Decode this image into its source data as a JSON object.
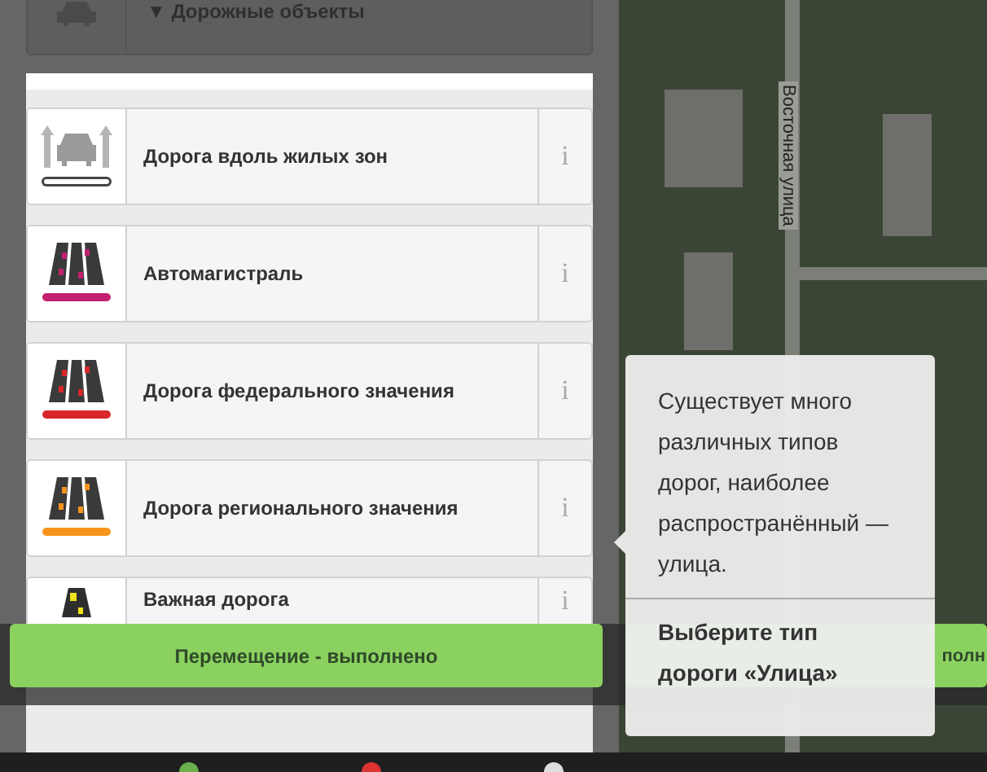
{
  "header": {
    "title": "▼ Дорожные объекты"
  },
  "road_types": [
    {
      "kind": "residential",
      "label": "Дорога вдоль жилых зон",
      "info": "i",
      "color": "#ffffff"
    },
    {
      "kind": "lanes",
      "label": "Автомагистраль",
      "info": "i",
      "color": "#c2206e"
    },
    {
      "kind": "lanes",
      "label": "Дорога федерального значения",
      "info": "i",
      "color": "#d8262a"
    },
    {
      "kind": "lanes",
      "label": "Дорога регионального значения",
      "info": "i",
      "color": "#f7941d"
    },
    {
      "kind": "narrow",
      "label": "Важная дорога",
      "info": "i",
      "color": "#f2e21c"
    }
  ],
  "map": {
    "street_label": "Восточная улица"
  },
  "toasts": [
    {
      "text": "Перемещение - выполнено"
    },
    {
      "text": "полн"
    }
  ],
  "tooltip": {
    "text": "Существует много различных типов дорог, наиболее распространённый — улица.",
    "instruction": "Выберите тип дороги «Улица»"
  }
}
